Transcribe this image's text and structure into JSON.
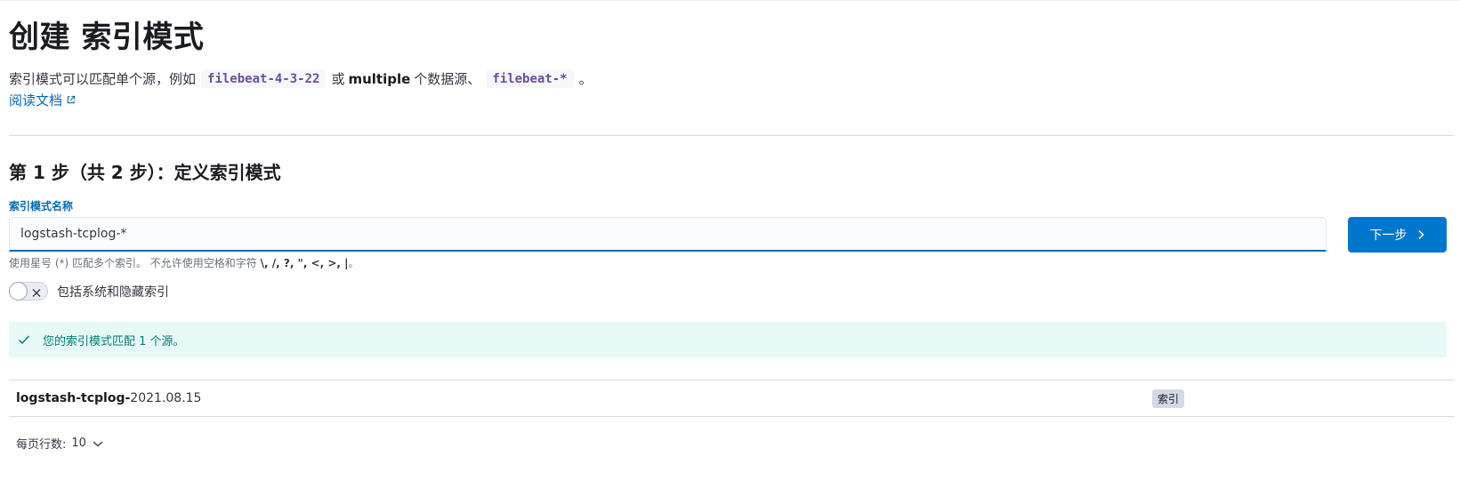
{
  "page": {
    "title": "创建 索引模式",
    "description": {
      "prefix": "索引模式可以匹配单个源，例如",
      "example_single": "filebeat-4-3-22",
      "or_text": "或",
      "multiple_text": "multiple",
      "middle_text": "个数据源、",
      "example_multiple": "filebeat-*",
      "suffix": "。"
    },
    "docs_link": "阅读文档"
  },
  "step": {
    "title": "第 1 步（共 2 步）：定义索引模式",
    "field_label": "索引模式名称",
    "input_value": "logstash-tcplog-*",
    "next_button": "下一步",
    "help_prefix": "使用星号 (*) 匹配多个索引。 不允许使用空格和字符 ",
    "help_chars": "\\, /, ?, \", <, >, |",
    "help_suffix": "。",
    "toggle_label": "包括系统和隐藏索引"
  },
  "callout": {
    "text": "您的索引模式匹配 1 个源。"
  },
  "results": {
    "rows": [
      {
        "name_match": "logstash-tcplog-",
        "name_rest": "2021.08.15",
        "badge": "索引"
      }
    ],
    "rows_per_page_label": "每页行数:",
    "rows_per_page_value": "10"
  },
  "colors": {
    "primary": "#0077cc",
    "link": "#006bb8",
    "success_bg": "#e6f9f7",
    "success_text": "#017d73",
    "code_text": "#6c4fa0"
  }
}
